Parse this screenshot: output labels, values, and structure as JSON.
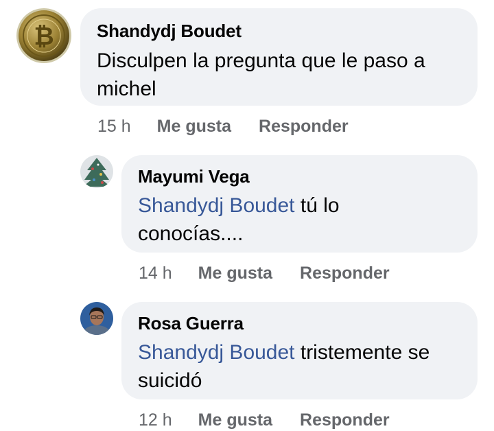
{
  "comments": [
    {
      "author": "Shandydj Boudet",
      "mention": "",
      "text": "Disculpen la pregunta que le paso a michel",
      "time": "15 h",
      "like_label": "Me gusta",
      "reply_label": "Responder",
      "avatar_icon": "bitcoin-coin-avatar-icon"
    },
    {
      "author": "Mayumi Vega",
      "mention": "Shandydj Boudet",
      "text": "tú lo conocías....",
      "time": "14 h",
      "like_label": "Me gusta",
      "reply_label": "Responder",
      "avatar_icon": "christmas-tree-avatar-icon"
    },
    {
      "author": "Rosa Guerra",
      "mention": "Shandydj Boudet",
      "text": "tristemente se suicidó",
      "time": "12 h",
      "like_label": "Me gusta",
      "reply_label": "Responder",
      "avatar_icon": "person-photo-avatar-icon"
    }
  ],
  "colors": {
    "bubble_bg": "#f0f2f5",
    "mention": "#385898",
    "secondary_text": "#65676b",
    "primary_text": "#050505"
  }
}
